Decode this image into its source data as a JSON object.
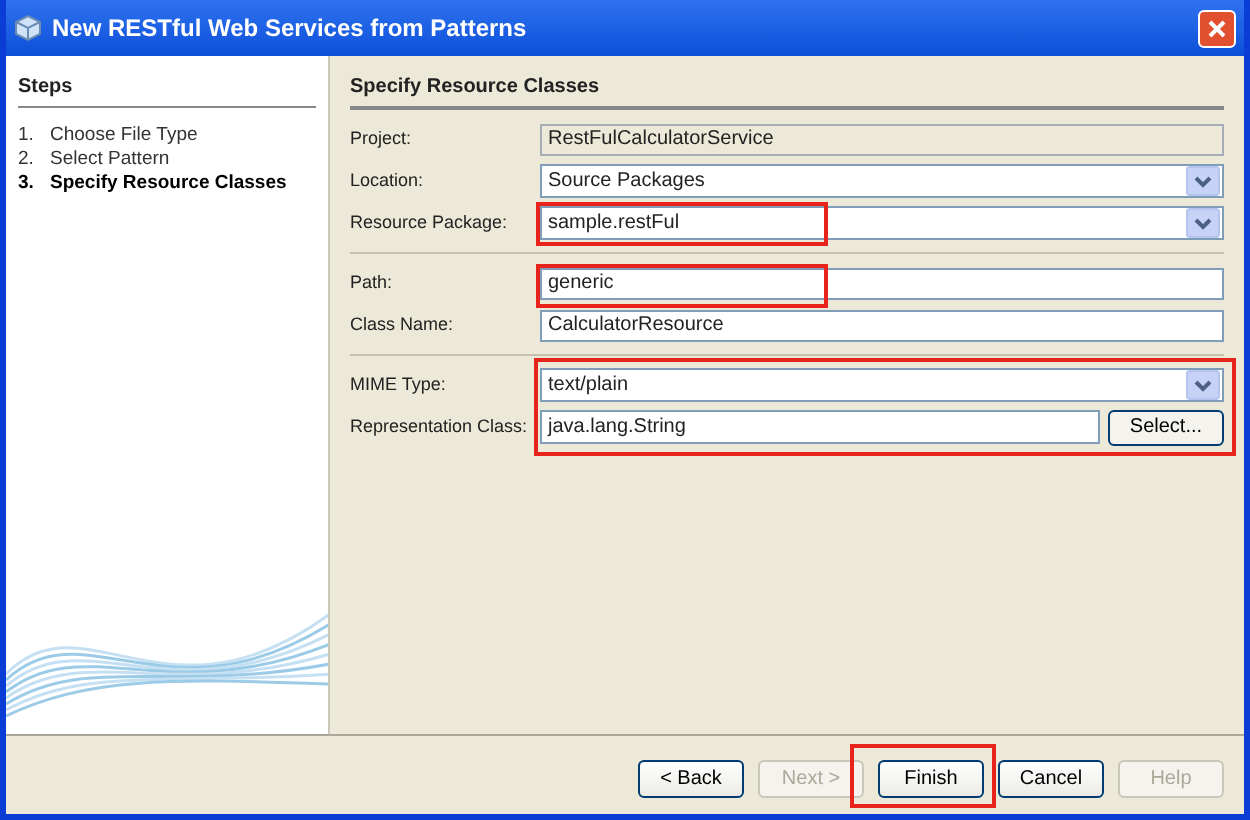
{
  "window": {
    "title": "New RESTful Web Services from Patterns"
  },
  "steps": {
    "title": "Steps",
    "items": [
      {
        "number": "1.",
        "label": "Choose File Type",
        "selected": false
      },
      {
        "number": "2.",
        "label": "Select Pattern",
        "selected": false
      },
      {
        "number": "3.",
        "label": "Specify Resource Classes",
        "selected": true
      }
    ]
  },
  "panel": {
    "title": "Specify Resource Classes"
  },
  "field_groups": [
    {
      "highlighted": false,
      "fields": [
        {
          "kind": "readonly",
          "label": "Project:",
          "value": "RestFulCalculatorService",
          "highlighted": false
        },
        {
          "kind": "combo",
          "label": "Location:",
          "value": "Source Packages",
          "highlighted": false
        },
        {
          "kind": "combo",
          "label": "Resource Package:",
          "value": "sample.restFul",
          "highlighted": true
        }
      ]
    },
    {
      "highlighted": false,
      "fields": [
        {
          "kind": "text",
          "label": "Path:",
          "value": "generic",
          "highlighted": true
        },
        {
          "kind": "text",
          "label": "Class Name:",
          "value": "CalculatorResource",
          "highlighted": false
        }
      ]
    },
    {
      "highlighted": true,
      "fields": [
        {
          "kind": "combo",
          "label": "MIME Type:",
          "value": "text/plain",
          "highlighted": false
        },
        {
          "kind": "browse",
          "label": "Representation Class:",
          "value": "java.lang.String",
          "button": "Select...",
          "highlighted": false
        }
      ]
    }
  ],
  "buttons": [
    {
      "label": "< Back",
      "disabled": false,
      "highlighted": false
    },
    {
      "label": "Next >",
      "disabled": true,
      "highlighted": false
    },
    {
      "label": "Finish",
      "disabled": false,
      "highlighted": true
    },
    {
      "label": "Cancel",
      "disabled": false,
      "highlighted": false
    },
    {
      "label": "Help",
      "disabled": true,
      "highlighted": false
    }
  ]
}
